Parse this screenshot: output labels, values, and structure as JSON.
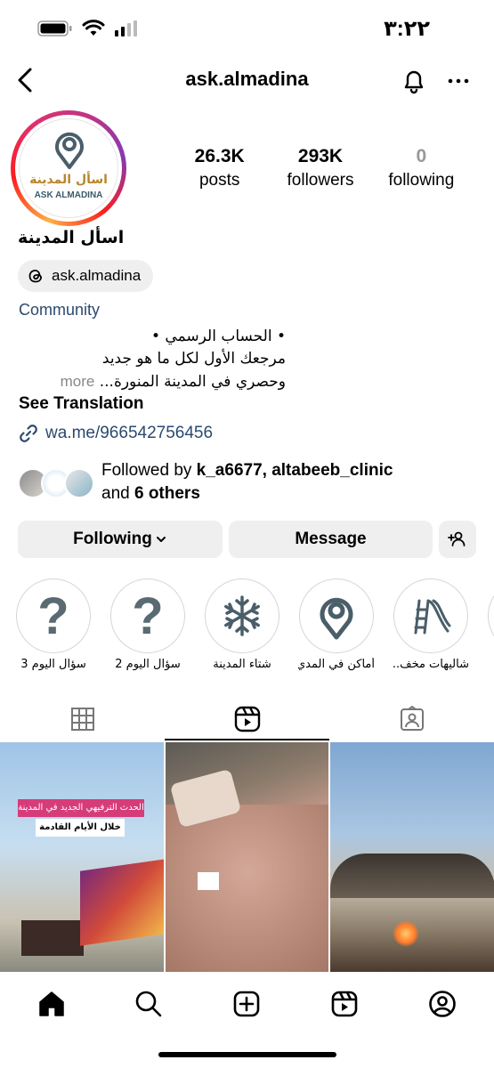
{
  "status_bar": {
    "time": "٣:٢٢",
    "icons": [
      "battery-icon",
      "wifi-icon",
      "signal-icon"
    ]
  },
  "header": {
    "title": "ask.almadina",
    "icons": [
      "back-chevron-icon",
      "bell-icon",
      "more-dots-icon"
    ]
  },
  "profile": {
    "avatar_text_ar": "اسأل المدينة",
    "avatar_text_en": "ASK ALMADINA",
    "name": "اسأل المدينة",
    "threads_handle": "ask.almadina",
    "category": "Community",
    "bio_lines": [
      "• الحساب الرسمي •",
      "مرجعك الأول لكل ما هو جديد",
      "وحصري في المدينة المنورة..."
    ],
    "bio_more": "more",
    "see_translation": "See Translation",
    "link": "wa.me/966542756456"
  },
  "stats": [
    {
      "value": "26.3K",
      "label": "posts"
    },
    {
      "value": "293K",
      "label": "followers"
    },
    {
      "value": "0",
      "label": "following"
    }
  ],
  "followed_by": {
    "prefix": "Followed by",
    "users": "k_a6677, altabeeb_clinic",
    "and": "and",
    "others": "6 others"
  },
  "actions": {
    "following": "Following",
    "message": "Message"
  },
  "highlights": [
    {
      "label": "سؤال اليوم 3",
      "icon": "question-mark-icon"
    },
    {
      "label": "سؤال اليوم 2",
      "icon": "question-mark-icon"
    },
    {
      "label": "شتاء المدينة",
      "icon": "snowflake-icon"
    },
    {
      "label": "أماكن في المدي...",
      "icon": "location-pin-icon"
    },
    {
      "label": "شاليهات مخف...",
      "icon": "slide-icon"
    }
  ],
  "tabs": [
    "grid-icon",
    "reels-icon",
    "tagged-icon"
  ],
  "posts": [
    {
      "tag1": "الحدث الترفيهي الجديد في المدينة",
      "tag2": "خلال الأيام القادمة"
    },
    {},
    {}
  ],
  "bottom_nav": [
    "home-icon",
    "search-icon",
    "create-icon",
    "reels-icon",
    "profile-icon"
  ]
}
